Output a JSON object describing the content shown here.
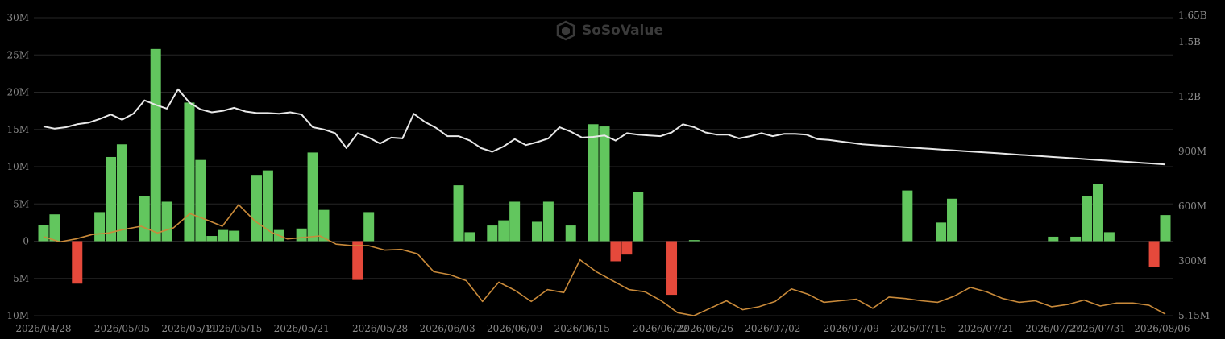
{
  "watermark": "SoSoValue",
  "chart_data": {
    "type": "bar",
    "x": [
      "2026/04/28",
      "2026/04/29",
      "2026/04/30",
      "2026/05/01",
      "2026/05/02",
      "2026/05/03",
      "2026/05/04",
      "2026/05/05",
      "2026/05/06",
      "2026/05/07",
      "2026/05/08",
      "2026/05/09",
      "2026/05/10",
      "2026/05/11",
      "2026/05/12",
      "2026/05/13",
      "2026/05/14",
      "2026/05/15",
      "2026/05/16",
      "2026/05/17",
      "2026/05/18",
      "2026/05/19",
      "2026/05/20",
      "2026/05/21",
      "2026/05/22",
      "2026/05/23",
      "2026/05/24",
      "2026/05/25",
      "2026/05/26",
      "2026/05/27",
      "2026/05/28",
      "2026/05/29",
      "2026/05/30",
      "2026/05/31",
      "2026/06/01",
      "2026/06/02",
      "2026/06/03",
      "2026/06/04",
      "2026/06/05",
      "2026/06/06",
      "2026/06/07",
      "2026/06/08",
      "2026/06/09",
      "2026/06/10",
      "2026/06/11",
      "2026/06/12",
      "2026/06/13",
      "2026/06/14",
      "2026/06/15",
      "2026/06/16",
      "2026/06/17",
      "2026/06/18",
      "2026/06/19",
      "2026/06/20",
      "2026/06/21",
      "2026/06/22",
      "2026/06/23",
      "2026/06/24",
      "2026/06/25",
      "2026/06/26",
      "2026/06/27",
      "2026/06/28",
      "2026/06/29",
      "2026/06/30",
      "2026/07/01",
      "2026/07/02",
      "2026/07/03",
      "2026/07/04",
      "2026/07/05",
      "2026/07/06",
      "2026/07/07",
      "2026/07/08",
      "2026/07/09",
      "2026/07/10",
      "2026/07/11",
      "2026/07/12",
      "2026/07/13",
      "2026/07/14",
      "2026/07/15",
      "2026/07/16",
      "2026/07/17",
      "2026/07/18",
      "2026/07/19",
      "2026/07/20",
      "2026/07/21",
      "2026/07/22",
      "2026/07/23",
      "2026/07/24",
      "2026/07/25",
      "2026/07/26",
      "2026/07/27",
      "2026/07/28",
      "2026/07/29",
      "2026/07/30",
      "2026/07/31",
      "2026/08/01",
      "2026/08/02",
      "2026/08/03",
      "2026/08/04",
      "2026/08/05",
      "2026/08/06"
    ],
    "x_tick_labels": [
      "2026/04/28",
      "2026/05/05",
      "2026/05/11",
      "2026/05/15",
      "2026/05/21",
      "2026/05/28",
      "2026/06/03",
      "2026/06/09",
      "2026/06/15",
      "2026/06/22",
      "2026/06/26",
      "2026/07/02",
      "2026/07/09",
      "2026/07/15",
      "2026/07/21",
      "2026/07/27",
      "2026/07/31",
      "2026/08/06"
    ],
    "left_axis": {
      "ylim": [
        -10000000,
        30000000
      ],
      "tick_values": [
        -10000000,
        -5000000,
        0,
        5000000,
        10000000,
        15000000,
        20000000,
        25000000,
        30000000
      ],
      "tick_labels": [
        "-10M",
        "-5M",
        "0",
        "5M",
        "10M",
        "15M",
        "20M",
        "25M",
        "30M"
      ]
    },
    "right_axis": {
      "ylim": [
        0,
        1650000000
      ],
      "tick_values": [
        0,
        1650000000
      ],
      "tick_labels": [
        "5.15M",
        "300M",
        "600M",
        "900M",
        "1.2B",
        "1.5B",
        "1.65B"
      ]
    },
    "bars": [
      {
        "x": "2026/04/28",
        "value": 2200000
      },
      {
        "x": "2026/04/29",
        "value": 3600000
      },
      {
        "x": "2026/05/01",
        "value": -5700000
      },
      {
        "x": "2026/05/03",
        "value": 3900000
      },
      {
        "x": "2026/05/04",
        "value": 11300000
      },
      {
        "x": "2026/05/05",
        "value": 13000000
      },
      {
        "x": "2026/05/07",
        "value": 6100000
      },
      {
        "x": "2026/05/08",
        "value": 25800000
      },
      {
        "x": "2026/05/09",
        "value": 5300000
      },
      {
        "x": "2026/05/11",
        "value": 18600000
      },
      {
        "x": "2026/05/12",
        "value": 10900000
      },
      {
        "x": "2026/05/13",
        "value": 700000
      },
      {
        "x": "2026/05/14",
        "value": 1500000
      },
      {
        "x": "2026/05/15",
        "value": 1400000
      },
      {
        "x": "2026/05/17",
        "value": 8900000
      },
      {
        "x": "2026/05/18",
        "value": 9500000
      },
      {
        "x": "2026/05/19",
        "value": 1500000
      },
      {
        "x": "2026/05/21",
        "value": 1700000
      },
      {
        "x": "2026/05/22",
        "value": 11900000
      },
      {
        "x": "2026/05/23",
        "value": 4200000
      },
      {
        "x": "2026/05/26",
        "value": -5200000
      },
      {
        "x": "2026/05/27",
        "value": 3900000
      },
      {
        "x": "2026/06/04",
        "value": 7500000
      },
      {
        "x": "2026/06/05",
        "value": 1200000
      },
      {
        "x": "2026/06/07",
        "value": 2100000
      },
      {
        "x": "2026/06/08",
        "value": 2800000
      },
      {
        "x": "2026/06/09",
        "value": 5300000
      },
      {
        "x": "2026/06/11",
        "value": 2600000
      },
      {
        "x": "2026/06/12",
        "value": 5300000
      },
      {
        "x": "2026/06/14",
        "value": 2100000
      },
      {
        "x": "2026/06/16",
        "value": 15700000
      },
      {
        "x": "2026/06/17",
        "value": 15400000
      },
      {
        "x": "2026/06/18",
        "value": -2700000
      },
      {
        "x": "2026/06/19",
        "value": -1800000
      },
      {
        "x": "2026/06/20",
        "value": 6600000
      },
      {
        "x": "2026/06/23",
        "value": -7200000
      },
      {
        "x": "2026/06/25",
        "value": 150000
      },
      {
        "x": "2026/07/14",
        "value": 6800000
      },
      {
        "x": "2026/07/17",
        "value": 2500000
      },
      {
        "x": "2026/07/18",
        "value": 5700000
      },
      {
        "x": "2026/07/27",
        "value": 600000
      },
      {
        "x": "2026/07/29",
        "value": 600000
      },
      {
        "x": "2026/07/30",
        "value": 6000000
      },
      {
        "x": "2026/07/31",
        "value": 7700000
      },
      {
        "x": "2026/08/01",
        "value": 1200000
      },
      {
        "x": "2026/08/05",
        "value": -3500000
      },
      {
        "x": "2026/08/06",
        "value": 3500000
      }
    ],
    "series": [
      {
        "color": "#e8e8e8",
        "values": [
          15400000,
          15100000,
          15300000,
          15700000,
          15900000,
          16400000,
          17000000,
          16300000,
          17100000,
          18900000,
          18300000,
          17800000,
          20400000,
          18600000,
          17700000,
          17300000,
          17500000,
          17900000,
          17400000,
          17200000,
          17200000,
          17100000,
          17300000,
          17000000,
          15300000,
          15000000,
          14500000,
          12500000,
          14500000,
          13900000,
          13100000,
          13900000,
          13800000,
          17100000,
          16000000,
          15200000,
          14100000,
          14100000,
          13500000,
          12500000,
          12000000,
          12700000,
          13700000,
          12900000,
          13300000,
          13800000,
          15300000,
          14700000,
          13900000,
          14000000,
          14200000,
          13500000,
          14500000,
          14300000,
          14200000,
          14100000,
          14600000,
          15700000,
          15300000,
          14600000,
          14300000,
          14300000,
          13800000,
          14100000,
          14500000,
          14100000,
          14400000,
          14400000,
          14300000,
          13700000,
          13600000,
          13400000,
          13200000,
          13000000,
          12900000,
          12800000,
          12700000,
          12600000,
          12500000,
          12400000,
          12300000,
          12200000,
          12100000,
          12000000,
          11900000,
          11800000,
          11700000,
          11600000,
          11500000,
          11400000,
          11300000,
          11200000,
          11100000,
          11000000,
          10900000,
          10800000,
          10700000,
          10600000,
          10500000,
          10400000,
          10300000
        ]
      },
      {
        "color": "#c98a3a",
        "values": [
          600000,
          -100000,
          300000,
          900000,
          1100000,
          1600000,
          2000000,
          1100000,
          1800000,
          3700000,
          2900000,
          2000000,
          4900000,
          2700000,
          1200000,
          300000,
          500000,
          700000,
          -400000,
          -600000,
          -600000,
          -1200000,
          -1100000,
          -1700000,
          -4100000,
          -4500000,
          -5300000,
          -8100000,
          -5500000,
          -6600000,
          -8100000,
          -6500000,
          -6900000,
          -2500000,
          -4100000,
          -5300000,
          -6500000,
          -6800000,
          -8000000,
          -9600000,
          -10000000,
          -9000000,
          -8000000,
          -9200000,
          -8800000,
          -8100000,
          -6400000,
          -7100000,
          -8200000,
          -8000000,
          -7800000,
          -9000000,
          -7500000,
          -7700000,
          -8000000,
          -8200000,
          -7400000,
          -6200000,
          -6800000,
          -7700000,
          -8200000,
          -8000000,
          -8800000,
          -8500000,
          -7900000,
          -8700000,
          -8300000,
          -8300000,
          -8600000,
          -9800000
        ]
      }
    ]
  }
}
